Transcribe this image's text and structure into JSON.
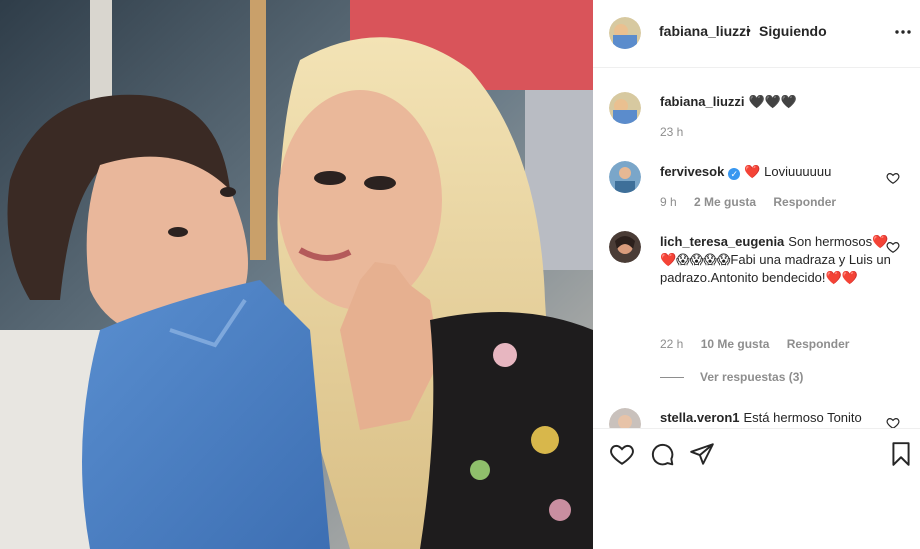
{
  "post": {
    "author": "fabiana_liuzzi",
    "separator": "•",
    "follow_status": "Siguiendo",
    "more_icon": "more-options-icon"
  },
  "caption": {
    "user": "fabiana_liuzzi",
    "text": "🖤🖤🖤",
    "time": "23 h"
  },
  "comments": [
    {
      "user": "fervivesok",
      "verified": true,
      "text": "❤️ Loviuuuuuu",
      "time": "9 h",
      "likes": "2 Me gusta",
      "reply": "Responder"
    },
    {
      "user": "lich_teresa_eugenia",
      "verified": false,
      "text": "Son hermosos❤️❤️😱😱😱😱Fabi una madraza y Luis un padrazo.Antonito bendecido!❤️❤️",
      "time": "22 h",
      "likes": "10 Me gusta",
      "reply": "Responder",
      "view_replies": "Ver respuestas (3)"
    },
    {
      "user": "stella.veron1",
      "verified": false,
      "text": "Está hermoso Tonito"
    }
  ],
  "colors": {
    "accent": "#3897f0",
    "heart": "#ed1c24",
    "muted": "#8e8e8e",
    "text": "#262626"
  }
}
